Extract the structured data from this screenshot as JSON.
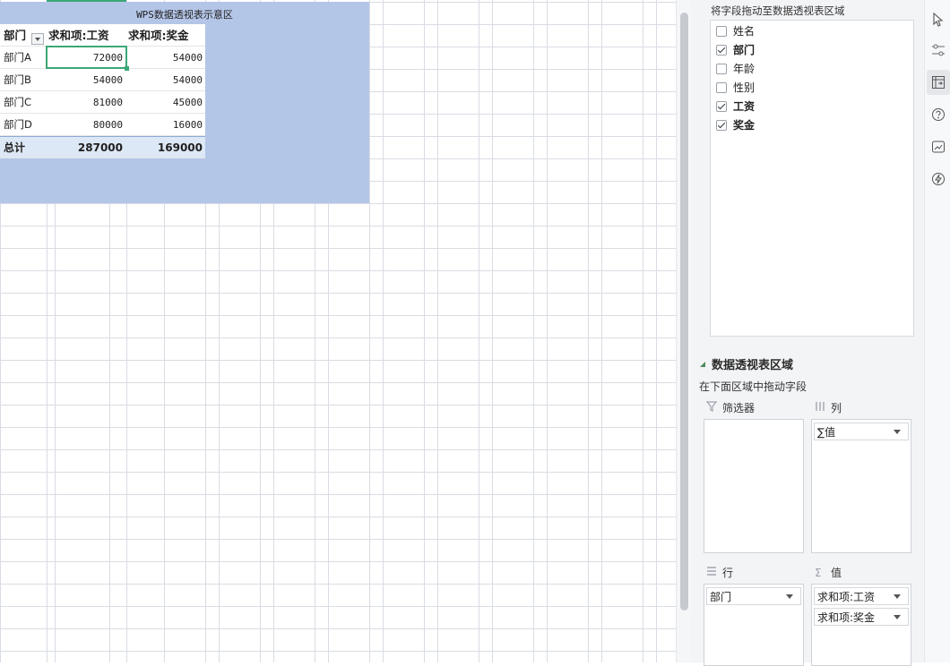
{
  "sheet": {
    "pivot_caption": "WPS数据透视表示意区",
    "pivot": {
      "headers": [
        "部门",
        "求和项:工资",
        "求和项:奖金"
      ],
      "rows": [
        [
          "部门A",
          "72000",
          "54000"
        ],
        [
          "部门B",
          "54000",
          "54000"
        ],
        [
          "部门C",
          "81000",
          "45000"
        ],
        [
          "部门D",
          "80000",
          "16000"
        ]
      ],
      "total": [
        "总计",
        "287000",
        "169000"
      ]
    }
  },
  "panel": {
    "title": "将字段拖动至数据透视表区域",
    "fields": [
      {
        "label": "姓名",
        "checked": false
      },
      {
        "label": "部门",
        "checked": true
      },
      {
        "label": "年龄",
        "checked": false
      },
      {
        "label": "性别",
        "checked": false
      },
      {
        "label": "工资",
        "checked": true
      },
      {
        "label": "奖金",
        "checked": true
      }
    ],
    "areas_title": "数据透视表区域",
    "areas_hint": "在下面区域中拖动字段",
    "zones": {
      "filter": {
        "label": "筛选器",
        "items": []
      },
      "columns": {
        "label": "列",
        "items": [
          "∑值"
        ]
      },
      "rows": {
        "label": "行",
        "items": [
          "部门"
        ]
      },
      "values": {
        "label": "值",
        "items": [
          "求和项:工资",
          "求和项:奖金"
        ]
      }
    }
  },
  "colors": {
    "pivot_area": "#b4c6e7",
    "total_row": "#dde8f6",
    "selection": "#3aa776",
    "panel_bg": "#f3f4f6"
  },
  "toolbar": {
    "icons": [
      "cursor-icon",
      "settings-sliders-icon",
      "pivot-table-icon",
      "help-icon",
      "chart-icon",
      "lightning-icon"
    ]
  }
}
